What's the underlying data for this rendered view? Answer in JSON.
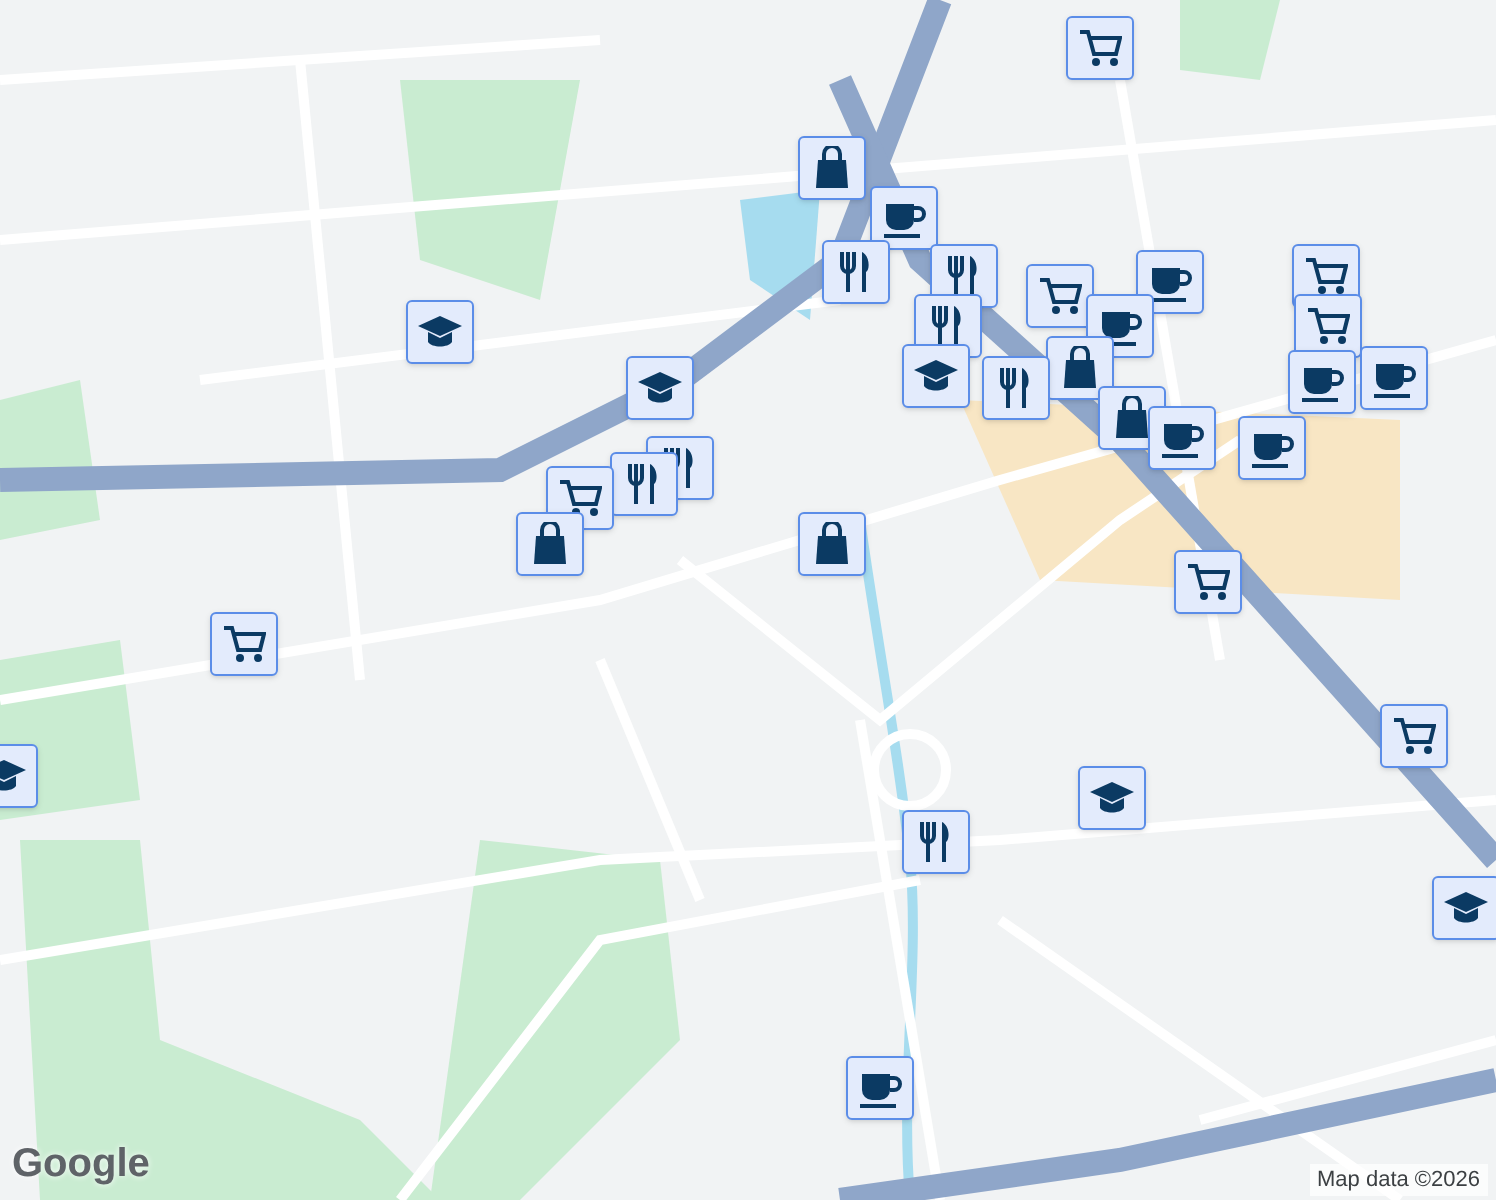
{
  "map": {
    "markers": [
      {
        "kind": "cart"
      },
      {
        "kind": "shopping"
      },
      {
        "kind": "coffee"
      },
      {
        "kind": "restaurant"
      },
      {
        "kind": "restaurant"
      },
      {
        "kind": "cart"
      },
      {
        "kind": "coffee"
      },
      {
        "kind": "cart"
      },
      {
        "kind": "restaurant"
      },
      {
        "kind": "cart"
      },
      {
        "kind": "coffee"
      },
      {
        "kind": "shopping"
      },
      {
        "kind": "school"
      },
      {
        "kind": "restaurant"
      },
      {
        "kind": "coffee"
      },
      {
        "kind": "shopping"
      },
      {
        "kind": "coffee"
      },
      {
        "kind": "coffee"
      },
      {
        "kind": "coffee"
      },
      {
        "kind": "school"
      },
      {
        "kind": "restaurant"
      },
      {
        "kind": "restaurant"
      },
      {
        "kind": "cart"
      },
      {
        "kind": "shopping"
      },
      {
        "kind": "shopping"
      },
      {
        "kind": "school"
      },
      {
        "kind": "cart"
      },
      {
        "kind": "school"
      },
      {
        "kind": "cart"
      },
      {
        "kind": "cart"
      },
      {
        "kind": "school"
      },
      {
        "kind": "restaurant"
      },
      {
        "kind": "school"
      },
      {
        "kind": "coffee"
      }
    ]
  },
  "logo": "Google",
  "attribution": "Map data ©2026"
}
